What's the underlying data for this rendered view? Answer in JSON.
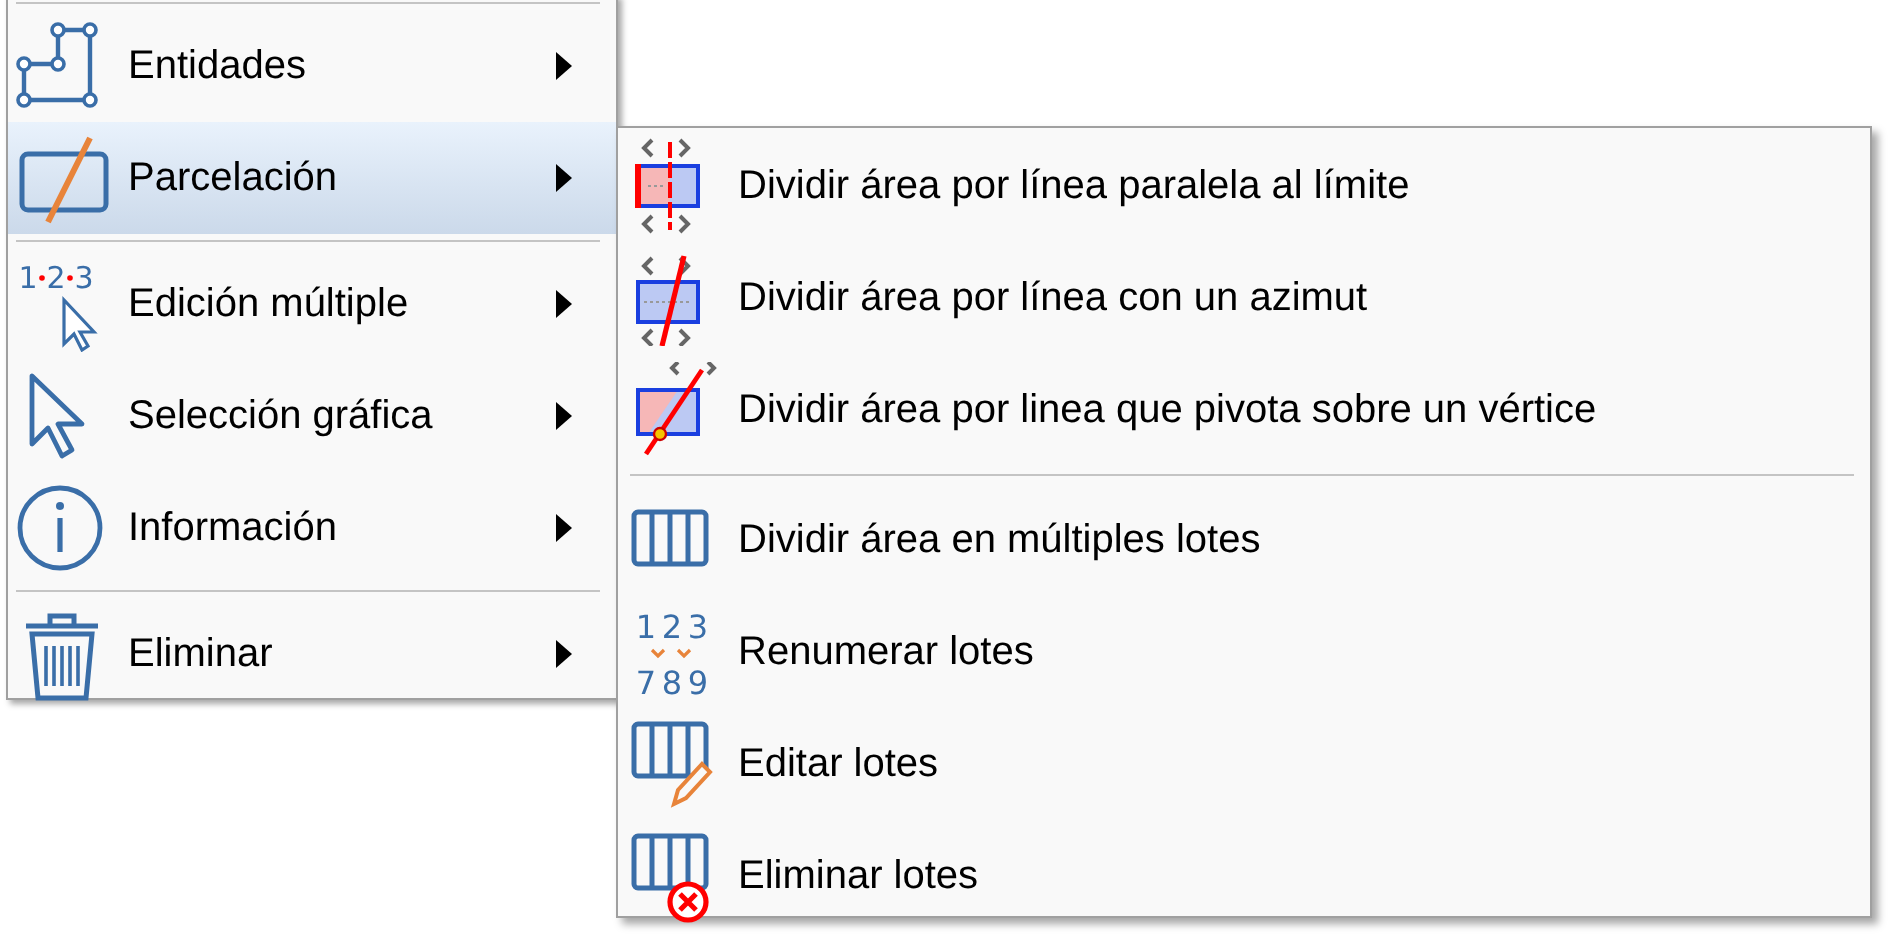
{
  "main_menu": {
    "items": [
      {
        "kind": "separator"
      },
      {
        "kind": "item",
        "label": "Entidades",
        "has_submenu": true,
        "selected": false
      },
      {
        "kind": "item",
        "label": "Parcelación",
        "has_submenu": true,
        "selected": true
      },
      {
        "kind": "separator"
      },
      {
        "kind": "item",
        "icon_text": [
          "1",
          "2",
          "3"
        ],
        "label": "Edición múltiple",
        "has_submenu": true,
        "selected": false
      },
      {
        "kind": "item",
        "label": "Selección gráfica",
        "has_submenu": true,
        "selected": false
      },
      {
        "kind": "item",
        "label": "Información",
        "has_submenu": true,
        "selected": false
      },
      {
        "kind": "separator"
      },
      {
        "kind": "item",
        "label": "Eliminar",
        "has_submenu": true,
        "selected": false
      }
    ]
  },
  "submenu": {
    "items": [
      {
        "kind": "item",
        "label": "Dividir área por línea paralela al límite",
        "selected": false
      },
      {
        "kind": "item",
        "label": "Dividir área por línea con un azimut",
        "selected": false
      },
      {
        "kind": "item",
        "label": "Dividir área por linea que pivota sobre un vértice",
        "selected": false
      },
      {
        "kind": "separator"
      },
      {
        "kind": "item",
        "label": "Dividir área en múltiples lotes",
        "selected": false
      },
      {
        "kind": "item",
        "icon_text": [
          "1",
          "2",
          "3",
          "7",
          "8",
          "9"
        ],
        "label": "Renumerar lotes",
        "selected": false
      },
      {
        "kind": "item",
        "label": "Editar lotes",
        "selected": false
      },
      {
        "kind": "item",
        "label": "Eliminar lotes",
        "selected": false
      }
    ]
  }
}
